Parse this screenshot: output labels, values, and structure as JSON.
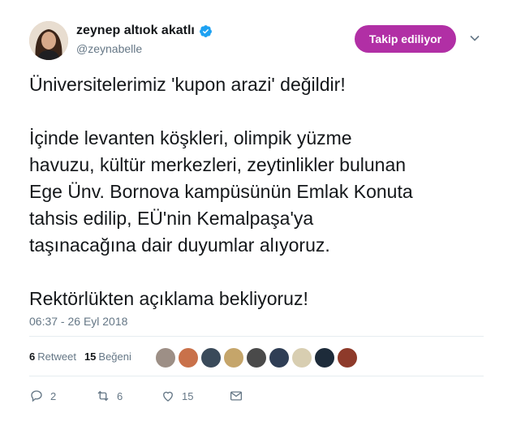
{
  "author": {
    "display_name": "zeynep altıok akatlı",
    "handle": "@zeynabelle",
    "verified": true
  },
  "follow_button": {
    "label": "Takip ediliyor",
    "color": "#b12fa5"
  },
  "tweet": {
    "text": "Üniversitelerimiz 'kupon arazi' değildir!\n\nİçinde levanten köşkleri, olimpik yüzme\nhavuzu, kültür merkezleri, zeytinlikler bulunan\nEge Ünv. Bornova kampüsünün Emlak Konuta\ntahsis edilip, EÜ'nin Kemalpaşa'ya\ntaşınacağına dair duyumlar alıyoruz.\n\nRektörlükten açıklama bekliyoruz!",
    "timestamp": "06:37 - 26 Eyl 2018"
  },
  "stats": {
    "retweets_count": "6",
    "retweets_label": "Retweet",
    "likes_count": "15",
    "likes_label": "Beğeni"
  },
  "likers": [
    {
      "color": "#9d8f86"
    },
    {
      "color": "#c9714a"
    },
    {
      "color": "#3a4a5a"
    },
    {
      "color": "#c5a56a"
    },
    {
      "color": "#4a4a4a"
    },
    {
      "color": "#2f3e55"
    },
    {
      "color": "#d8ceb1"
    },
    {
      "color": "#1d2b3a"
    },
    {
      "color": "#8e3a2a"
    }
  ],
  "actions": {
    "reply_count": "2",
    "retweet_count": "6",
    "like_count": "15"
  },
  "colors": {
    "text": "#14171a",
    "muted": "#657786",
    "verified": "#1da1f2",
    "divider": "#e6ecf0"
  }
}
